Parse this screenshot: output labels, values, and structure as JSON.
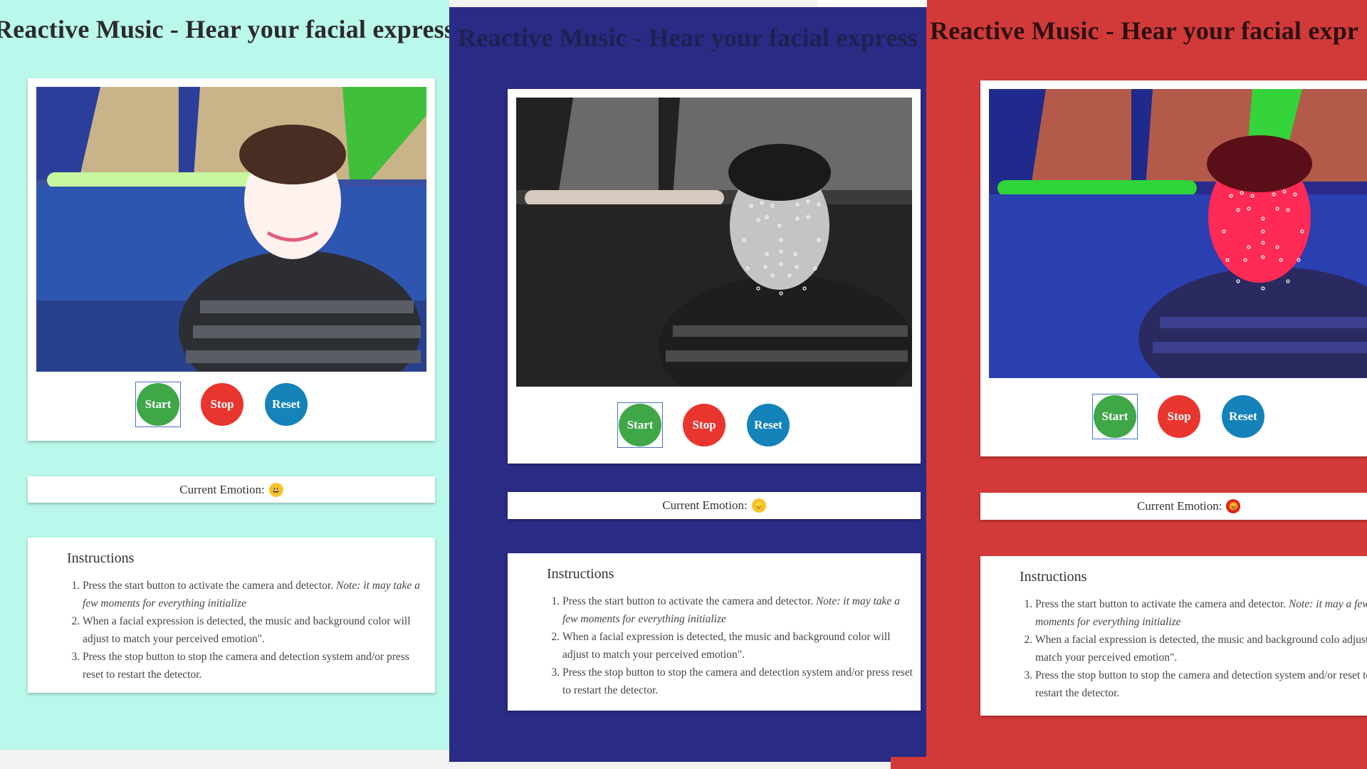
{
  "app_title": "Reactive Music - Hear your facial expressi",
  "panels": [
    {
      "title": "Reactive Music - Hear your facial expressi",
      "background": "#b9f8ea",
      "theme": "happy",
      "camera_filter": "normal",
      "buttons": {
        "start": "Start",
        "stop": "Stop",
        "reset": "Reset"
      },
      "emotion_label": "Current Emotion:",
      "emotion_icon": "grinning-face-icon",
      "emotion_emoji": "😃",
      "instructions": {
        "heading": "Instructions",
        "step1": "Press the start button to activate the camera and detector. ",
        "step1_note": "Note: it may take a few moments for everything initialize",
        "step2": "When a facial expression is detected, the music and background color will adjust to match your perceived emotion\".",
        "step3": "Press the stop button to stop the camera and detection system and/or press reset to restart the detector."
      }
    },
    {
      "title": "Reactive Music - Hear your facial express",
      "background": "#292b85",
      "theme": "sad",
      "camera_filter": "grayscale",
      "buttons": {
        "start": "Start",
        "stop": "Stop",
        "reset": "Reset"
      },
      "emotion_label": "Current Emotion:",
      "emotion_icon": "disappointed-face-icon",
      "emotion_emoji": "😞",
      "instructions": {
        "heading": "Instructions",
        "step1": "Press the start button to activate the camera and detector. ",
        "step1_note": "Note: it may take a few moments for everything initialize",
        "step2": "When a facial expression is detected, the music and background color will adjust to match your perceived emotion\".",
        "step3": "Press the stop button to stop the camera and detection system and/or press reset to restart the detector."
      }
    },
    {
      "title": "Reactive Music - Hear your facial expr",
      "background": "#d23a39",
      "theme": "angry",
      "camera_filter": "red-tint",
      "buttons": {
        "start": "Start",
        "stop": "Stop",
        "reset": "Reset"
      },
      "emotion_label": "Current Emotion:",
      "emotion_icon": "angry-face-icon",
      "emotion_emoji": "😡",
      "instructions": {
        "heading": "Instructions",
        "step1": "Press the start button to activate the camera and detector. ",
        "step1_note": "Note: it may a few moments for everything initialize",
        "step2": "When a facial expression is detected, the music and background colo adjust to match your perceived emotion\".",
        "step3": "Press the stop button to stop the camera and detection system and/or reset to restart the detector."
      }
    }
  ],
  "colors": {
    "start_button": "#3fa748",
    "stop_button": "#e8352e",
    "reset_button": "#1483b9",
    "card": "#ffffff"
  }
}
